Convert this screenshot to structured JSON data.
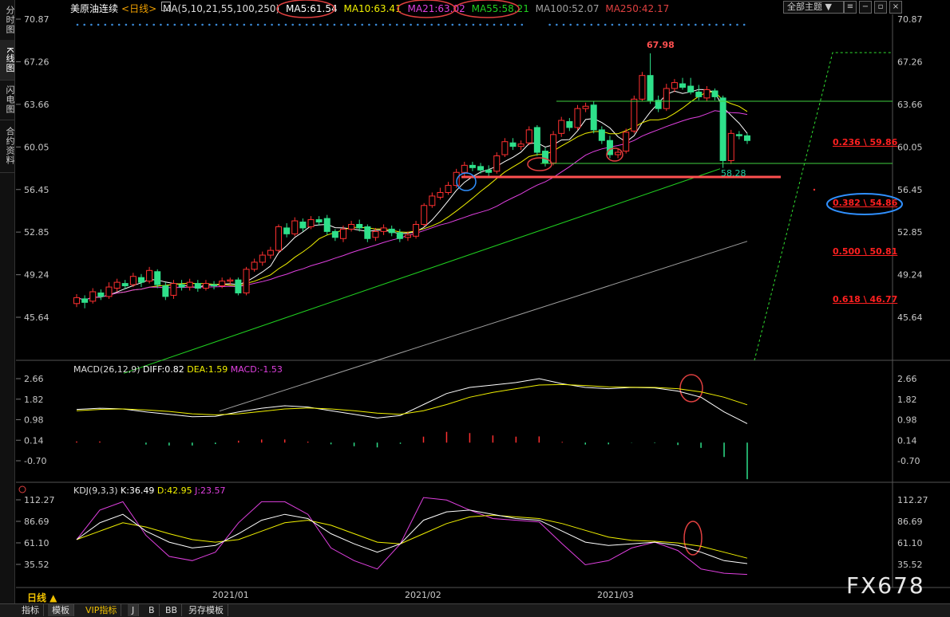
{
  "header": {
    "title": "美原油连续",
    "period": "<日线>",
    "ma_params": "MA(5,10,21,55,100,250)",
    "ma5": "MA5:61.54",
    "ma10": "MA10:63.41",
    "ma21": "MA21:63.02",
    "ma55": "MA55:58.21",
    "ma100": "MA100:52.07",
    "ma250": "MA250:42.17",
    "theme_select": "全部主题"
  },
  "left_tabs": [
    "分时图",
    "K线图",
    "闪电图",
    "合约资料"
  ],
  "colors": {
    "up": "#ff3030",
    "down": "#2ee08a",
    "ma5": "#ffffff",
    "ma10": "#f0f000",
    "ma21": "#e040e0",
    "ma55": "#20d020",
    "ma100": "#a0a0a0",
    "axis_text": "#c8c8c8",
    "fib": "#ff2020",
    "annot_red": "#e04040",
    "annot_blue": "#3090ff"
  },
  "price_axis": [
    "70.87",
    "67.26",
    "63.66",
    "60.05",
    "56.45",
    "52.85",
    "49.24",
    "45.64"
  ],
  "macd_axis": [
    "2.66",
    "1.82",
    "0.98",
    "0.14",
    "-0.70"
  ],
  "kdj_axis": [
    "112.27",
    "86.69",
    "61.10",
    "35.52"
  ],
  "annotations": {
    "high_label": "67.98",
    "low_label": "58.28",
    "fib": [
      {
        "label": "0.236 \\ 59.86",
        "value": 59.86
      },
      {
        "label": "0.382 \\ 54.86",
        "value": 54.86
      },
      {
        "label": "0.500 \\ 50.81",
        "value": 50.81
      },
      {
        "label": "0.618 \\ 46.77",
        "value": 46.77
      }
    ]
  },
  "macd": {
    "title": "MACD(26,12,9)",
    "diff": "DIFF:0.82",
    "dea": "DEA:1.59",
    "macd": "MACD:-1.53"
  },
  "kdj": {
    "title": "KDJ(9,3,3)",
    "k": "K:36.49",
    "d": "D:42.95",
    "j": "J:23.57"
  },
  "x_dates": [
    "2021/01",
    "2021/02",
    "2021/03"
  ],
  "period_label": "日线 ▲",
  "bottom_tabs": [
    "指标",
    "模板",
    "VIP指标",
    "J",
    "B",
    "BB",
    "另存模板"
  ],
  "watermark": "FX678",
  "chart_data": [
    {
      "type": "candlestick",
      "title": "美原油连续 <日线>",
      "ylim": [
        45.64,
        70.87
      ],
      "candles": [
        {
          "o": 46.8,
          "c": 47.3,
          "h": 47.6,
          "l": 46.5
        },
        {
          "o": 47.2,
          "c": 46.9,
          "h": 47.5,
          "l": 46.4
        },
        {
          "o": 47.0,
          "c": 47.8,
          "h": 48.1,
          "l": 46.8
        },
        {
          "o": 47.7,
          "c": 47.4,
          "h": 48.0,
          "l": 47.1
        },
        {
          "o": 47.4,
          "c": 48.2,
          "h": 48.6,
          "l": 47.2
        },
        {
          "o": 48.1,
          "c": 48.6,
          "h": 48.9,
          "l": 47.8
        },
        {
          "o": 48.5,
          "c": 48.3,
          "h": 48.8,
          "l": 48.0
        },
        {
          "o": 48.4,
          "c": 49.1,
          "h": 49.4,
          "l": 48.2
        },
        {
          "o": 49.0,
          "c": 48.6,
          "h": 49.3,
          "l": 48.2
        },
        {
          "o": 48.7,
          "c": 49.6,
          "h": 49.9,
          "l": 48.5
        },
        {
          "o": 49.5,
          "c": 48.4,
          "h": 49.7,
          "l": 48.1
        },
        {
          "o": 48.3,
          "c": 47.4,
          "h": 48.6,
          "l": 47.1
        },
        {
          "o": 47.5,
          "c": 48.5,
          "h": 48.8,
          "l": 47.2
        },
        {
          "o": 48.4,
          "c": 48.2,
          "h": 48.8,
          "l": 47.9
        },
        {
          "o": 48.2,
          "c": 48.6,
          "h": 48.9,
          "l": 47.9
        },
        {
          "o": 48.5,
          "c": 48.1,
          "h": 48.8,
          "l": 47.8
        },
        {
          "o": 48.1,
          "c": 48.5,
          "h": 48.8,
          "l": 47.9
        },
        {
          "o": 48.4,
          "c": 48.3,
          "h": 48.7,
          "l": 48.0
        },
        {
          "o": 48.3,
          "c": 48.7,
          "h": 49.0,
          "l": 48.1
        },
        {
          "o": 48.7,
          "c": 48.8,
          "h": 49.0,
          "l": 48.4
        },
        {
          "o": 48.8,
          "c": 47.7,
          "h": 49.0,
          "l": 47.5
        },
        {
          "o": 47.7,
          "c": 49.7,
          "h": 49.9,
          "l": 47.5
        },
        {
          "o": 49.7,
          "c": 50.3,
          "h": 50.6,
          "l": 49.5
        },
        {
          "o": 50.3,
          "c": 50.9,
          "h": 51.2,
          "l": 50.0
        },
        {
          "o": 50.9,
          "c": 51.3,
          "h": 51.6,
          "l": 50.6
        },
        {
          "o": 51.3,
          "c": 53.3,
          "h": 53.5,
          "l": 51.1
        },
        {
          "o": 53.2,
          "c": 52.7,
          "h": 53.6,
          "l": 52.4
        },
        {
          "o": 52.7,
          "c": 53.8,
          "h": 54.1,
          "l": 52.5
        },
        {
          "o": 53.7,
          "c": 53.2,
          "h": 54.0,
          "l": 52.9
        },
        {
          "o": 53.3,
          "c": 53.9,
          "h": 54.2,
          "l": 53.1
        },
        {
          "o": 53.9,
          "c": 53.7,
          "h": 54.2,
          "l": 53.4
        },
        {
          "o": 54.0,
          "c": 52.9,
          "h": 54.3,
          "l": 52.6
        },
        {
          "o": 52.9,
          "c": 52.4,
          "h": 53.1,
          "l": 52.1
        },
        {
          "o": 52.3,
          "c": 53.1,
          "h": 53.4,
          "l": 52.0
        },
        {
          "o": 53.1,
          "c": 53.5,
          "h": 53.8,
          "l": 52.9
        },
        {
          "o": 53.5,
          "c": 53.2,
          "h": 53.9,
          "l": 52.9
        },
        {
          "o": 53.3,
          "c": 52.3,
          "h": 53.5,
          "l": 52.0
        },
        {
          "o": 52.4,
          "c": 52.9,
          "h": 53.2,
          "l": 52.1
        },
        {
          "o": 52.9,
          "c": 53.2,
          "h": 53.5,
          "l": 52.6
        },
        {
          "o": 53.1,
          "c": 52.8,
          "h": 53.4,
          "l": 52.5
        },
        {
          "o": 52.8,
          "c": 52.3,
          "h": 53.1,
          "l": 52.0
        },
        {
          "o": 52.4,
          "c": 52.6,
          "h": 52.9,
          "l": 52.1
        },
        {
          "o": 52.5,
          "c": 53.5,
          "h": 53.8,
          "l": 52.3
        },
        {
          "o": 53.5,
          "c": 55.1,
          "h": 55.3,
          "l": 53.3
        },
        {
          "o": 55.1,
          "c": 55.9,
          "h": 56.2,
          "l": 54.9
        },
        {
          "o": 55.8,
          "c": 56.2,
          "h": 56.6,
          "l": 55.6
        },
        {
          "o": 56.2,
          "c": 56.8,
          "h": 57.1,
          "l": 56.0
        },
        {
          "o": 56.8,
          "c": 57.9,
          "h": 58.2,
          "l": 56.6
        },
        {
          "o": 57.9,
          "c": 58.5,
          "h": 58.8,
          "l": 57.6
        },
        {
          "o": 58.5,
          "c": 58.3,
          "h": 58.8,
          "l": 58.0
        },
        {
          "o": 58.4,
          "c": 58.1,
          "h": 58.7,
          "l": 57.8
        },
        {
          "o": 58.1,
          "c": 57.9,
          "h": 58.5,
          "l": 57.6
        },
        {
          "o": 58.0,
          "c": 59.3,
          "h": 59.6,
          "l": 57.8
        },
        {
          "o": 59.4,
          "c": 60.5,
          "h": 60.8,
          "l": 59.2
        },
        {
          "o": 60.4,
          "c": 60.1,
          "h": 60.8,
          "l": 59.8
        },
        {
          "o": 60.1,
          "c": 60.3,
          "h": 60.6,
          "l": 59.8
        },
        {
          "o": 60.4,
          "c": 61.5,
          "h": 61.8,
          "l": 60.2
        },
        {
          "o": 61.7,
          "c": 59.6,
          "h": 61.9,
          "l": 59.3
        },
        {
          "o": 59.7,
          "c": 58.7,
          "h": 60.0,
          "l": 58.4
        },
        {
          "o": 58.7,
          "c": 61.1,
          "h": 61.4,
          "l": 58.5
        },
        {
          "o": 61.2,
          "c": 62.3,
          "h": 62.6,
          "l": 60.9
        },
        {
          "o": 62.2,
          "c": 61.7,
          "h": 62.5,
          "l": 61.4
        },
        {
          "o": 61.7,
          "c": 63.3,
          "h": 63.6,
          "l": 61.5
        },
        {
          "o": 63.3,
          "c": 63.5,
          "h": 63.8,
          "l": 63.0
        },
        {
          "o": 63.6,
          "c": 61.5,
          "h": 63.9,
          "l": 61.2
        },
        {
          "o": 61.5,
          "c": 60.6,
          "h": 61.8,
          "l": 60.3
        },
        {
          "o": 60.6,
          "c": 59.4,
          "h": 61.0,
          "l": 59.1
        },
        {
          "o": 59.4,
          "c": 59.6,
          "h": 59.9,
          "l": 59.1
        },
        {
          "o": 59.7,
          "c": 61.3,
          "h": 61.6,
          "l": 59.5
        },
        {
          "o": 61.4,
          "c": 64.1,
          "h": 64.4,
          "l": 61.2
        },
        {
          "o": 64.1,
          "c": 66.1,
          "h": 66.4,
          "l": 63.9
        },
        {
          "o": 66.1,
          "c": 64.0,
          "h": 67.98,
          "l": 63.7
        },
        {
          "o": 64.0,
          "c": 63.3,
          "h": 64.4,
          "l": 63.0
        },
        {
          "o": 63.3,
          "c": 65.0,
          "h": 65.4,
          "l": 63.1
        },
        {
          "o": 65.0,
          "c": 65.5,
          "h": 65.8,
          "l": 64.7
        },
        {
          "o": 65.4,
          "c": 65.1,
          "h": 65.9,
          "l": 64.9
        },
        {
          "o": 65.2,
          "c": 64.7,
          "h": 65.9,
          "l": 64.5
        },
        {
          "o": 64.7,
          "c": 64.3,
          "h": 65.3,
          "l": 64.0
        },
        {
          "o": 64.2,
          "c": 64.9,
          "h": 65.2,
          "l": 63.9
        },
        {
          "o": 64.8,
          "c": 64.3,
          "h": 65.0,
          "l": 64.0
        },
        {
          "o": 64.2,
          "c": 58.9,
          "h": 64.4,
          "l": 58.28
        },
        {
          "o": 58.9,
          "c": 61.2,
          "h": 61.5,
          "l": 58.6
        },
        {
          "o": 61.1,
          "c": 61.0,
          "h": 61.4,
          "l": 60.7
        },
        {
          "o": 61.0,
          "c": 60.6,
          "h": 61.2,
          "l": 60.3
        }
      ]
    },
    {
      "type": "line",
      "title": "MACD(26,12,9)",
      "ylim": [
        -0.7,
        2.66
      ],
      "series": [
        {
          "name": "DIFF",
          "values": [
            1.4,
            1.45,
            1.42,
            1.3,
            1.2,
            1.1,
            1.12,
            1.3,
            1.45,
            1.55,
            1.5,
            1.35,
            1.2,
            1.05,
            1.15,
            1.6,
            2.05,
            2.3,
            2.4,
            2.5,
            2.66,
            2.45,
            2.3,
            2.25,
            2.3,
            2.28,
            2.15,
            1.9,
            1.3,
            0.82
          ]
        },
        {
          "name": "DEA",
          "values": [
            1.35,
            1.4,
            1.42,
            1.38,
            1.32,
            1.22,
            1.18,
            1.22,
            1.32,
            1.42,
            1.46,
            1.42,
            1.35,
            1.25,
            1.2,
            1.35,
            1.6,
            1.9,
            2.1,
            2.25,
            2.4,
            2.42,
            2.38,
            2.32,
            2.31,
            2.3,
            2.25,
            2.12,
            1.9,
            1.59
          ]
        },
        {
          "name": "MACD",
          "values": [
            0.05,
            0.05,
            0.0,
            -0.08,
            -0.12,
            -0.12,
            -0.06,
            0.08,
            0.13,
            0.13,
            0.04,
            -0.07,
            -0.15,
            -0.2,
            -0.05,
            0.25,
            0.45,
            0.4,
            0.3,
            0.25,
            0.26,
            0.03,
            -0.08,
            -0.07,
            -0.01,
            -0.02,
            -0.1,
            -0.22,
            -0.6,
            -1.53
          ]
        }
      ]
    },
    {
      "type": "line",
      "title": "KDJ(9,3,3)",
      "ylim": [
        35.52,
        112.27
      ],
      "series": [
        {
          "name": "K",
          "values": [
            65,
            85,
            95,
            75,
            62,
            55,
            58,
            72,
            88,
            95,
            90,
            72,
            60,
            50,
            60,
            88,
            98,
            100,
            95,
            90,
            88,
            75,
            62,
            58,
            60,
            62,
            58,
            50,
            40,
            36.49
          ]
        },
        {
          "name": "D",
          "values": [
            65,
            75,
            85,
            80,
            72,
            65,
            62,
            65,
            75,
            85,
            88,
            82,
            72,
            62,
            60,
            72,
            84,
            92,
            94,
            92,
            90,
            84,
            76,
            68,
            64,
            63,
            61,
            57,
            50,
            42.95
          ]
        },
        {
          "name": "J",
          "values": [
            65,
            100,
            110,
            70,
            45,
            40,
            50,
            85,
            110,
            110,
            95,
            55,
            40,
            30,
            60,
            115,
            112,
            100,
            90,
            88,
            86,
            60,
            35,
            40,
            55,
            62,
            52,
            30,
            25,
            23.57
          ]
        }
      ]
    }
  ]
}
